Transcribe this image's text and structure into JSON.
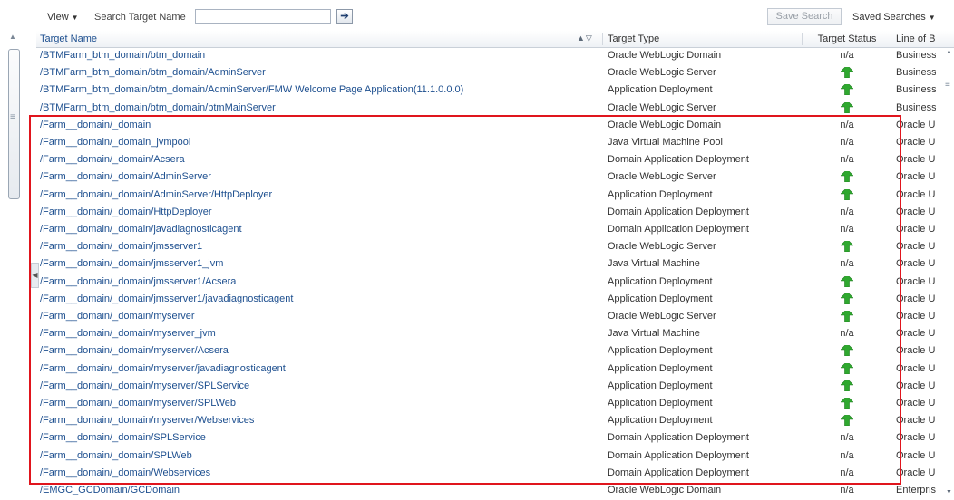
{
  "toolbar": {
    "view_label": "View",
    "search_label": "Search Target Name",
    "search_value": "",
    "save_search_label": "Save Search",
    "saved_searches_label": "Saved Searches"
  },
  "columns": {
    "name": "Target Name",
    "type": "Target Type",
    "status": "Target Status",
    "lob": "Line of B"
  },
  "rows": [
    {
      "name": "/BTMFarm_btm_domain/btm_domain",
      "type": "Oracle WebLogic Domain",
      "status": "n/a",
      "lob": "Business"
    },
    {
      "name": "/BTMFarm_btm_domain/btm_domain/AdminServer",
      "type": "Oracle WebLogic Server",
      "status": "up",
      "lob": "Business"
    },
    {
      "name": "/BTMFarm_btm_domain/btm_domain/AdminServer/FMW Welcome Page Application(11.1.0.0.0)",
      "type": "Application Deployment",
      "status": "up",
      "lob": "Business"
    },
    {
      "name": "/BTMFarm_btm_domain/btm_domain/btmMainServer",
      "type": "Oracle WebLogic Server",
      "status": "up",
      "lob": "Business"
    },
    {
      "name": "/Farm__domain/_domain",
      "type": "Oracle WebLogic Domain",
      "status": "n/a",
      "lob": "Oracle U"
    },
    {
      "name": "/Farm__domain/_domain_jvmpool",
      "type": "Java Virtual Machine Pool",
      "status": "n/a",
      "lob": "Oracle U"
    },
    {
      "name": "/Farm__domain/_domain/Acsera",
      "type": "Domain Application Deployment",
      "status": "n/a",
      "lob": "Oracle U"
    },
    {
      "name": "/Farm__domain/_domain/AdminServer",
      "type": "Oracle WebLogic Server",
      "status": "up",
      "lob": "Oracle U"
    },
    {
      "name": "/Farm__domain/_domain/AdminServer/HttpDeployer",
      "type": "Application Deployment",
      "status": "up",
      "lob": "Oracle U"
    },
    {
      "name": "/Farm__domain/_domain/HttpDeployer",
      "type": "Domain Application Deployment",
      "status": "n/a",
      "lob": "Oracle U"
    },
    {
      "name": "/Farm__domain/_domain/javadiagnosticagent",
      "type": "Domain Application Deployment",
      "status": "n/a",
      "lob": "Oracle U"
    },
    {
      "name": "/Farm__domain/_domain/jmsserver1",
      "type": "Oracle WebLogic Server",
      "status": "up",
      "lob": "Oracle U"
    },
    {
      "name": "/Farm__domain/_domain/jmsserver1_jvm",
      "type": "Java Virtual Machine",
      "status": "n/a",
      "lob": "Oracle U"
    },
    {
      "name": "/Farm__domain/_domain/jmsserver1/Acsera",
      "type": "Application Deployment",
      "status": "up",
      "lob": "Oracle U"
    },
    {
      "name": "/Farm__domain/_domain/jmsserver1/javadiagnosticagent",
      "type": "Application Deployment",
      "status": "up",
      "lob": "Oracle U"
    },
    {
      "name": "/Farm__domain/_domain/myserver",
      "type": "Oracle WebLogic Server",
      "status": "up",
      "lob": "Oracle U"
    },
    {
      "name": "/Farm__domain/_domain/myserver_jvm",
      "type": "Java Virtual Machine",
      "status": "n/a",
      "lob": "Oracle U"
    },
    {
      "name": "/Farm__domain/_domain/myserver/Acsera",
      "type": "Application Deployment",
      "status": "up",
      "lob": "Oracle U"
    },
    {
      "name": "/Farm__domain/_domain/myserver/javadiagnosticagent",
      "type": "Application Deployment",
      "status": "up",
      "lob": "Oracle U"
    },
    {
      "name": "/Farm__domain/_domain/myserver/SPLService",
      "type": "Application Deployment",
      "status": "up",
      "lob": "Oracle U"
    },
    {
      "name": "/Farm__domain/_domain/myserver/SPLWeb",
      "type": "Application Deployment",
      "status": "up",
      "lob": "Oracle U"
    },
    {
      "name": "/Farm__domain/_domain/myserver/Webservices",
      "type": "Application Deployment",
      "status": "up",
      "lob": "Oracle U"
    },
    {
      "name": "/Farm__domain/_domain/SPLService",
      "type": "Domain Application Deployment",
      "status": "n/a",
      "lob": "Oracle U"
    },
    {
      "name": "/Farm__domain/_domain/SPLWeb",
      "type": "Domain Application Deployment",
      "status": "n/a",
      "lob": "Oracle U"
    },
    {
      "name": "/Farm__domain/_domain/Webservices",
      "type": "Domain Application Deployment",
      "status": "n/a",
      "lob": "Oracle U"
    },
    {
      "name": "/EMGC_GCDomain/GCDomain",
      "type": "Oracle WebLogic Domain",
      "status": "n/a",
      "lob": "Enterpris"
    }
  ],
  "colors": {
    "link": "#1d4f8f",
    "status_up": "#2fa82f",
    "highlight": "#e0151d"
  },
  "icons": {
    "status_up": "green-up-arrow-icon",
    "sort": "sort-asc-desc-icon"
  }
}
